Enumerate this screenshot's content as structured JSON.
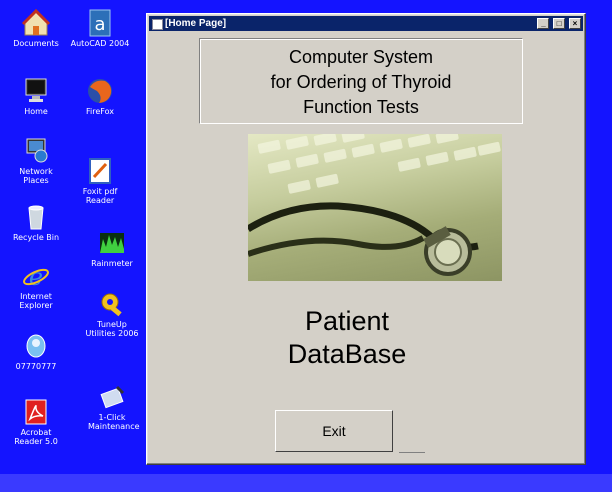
{
  "desktop": {
    "icons": [
      {
        "label": "Documents"
      },
      {
        "label": "AutoCAD 2004"
      },
      {
        "label": "Home"
      },
      {
        "label": "FireFox"
      },
      {
        "label": "Network Places"
      },
      {
        "label": "Foxit pdf Reader"
      },
      {
        "label": "Recycle Bin"
      },
      {
        "label": "Rainmeter"
      },
      {
        "label": "Internet Explorer"
      },
      {
        "label": "TuneUp Utilities 2006"
      },
      {
        "label": "07770777"
      },
      {
        "label": "1-Click Maintenance"
      },
      {
        "label": "Acrobat Reader 5.0"
      }
    ]
  },
  "window": {
    "title": "[Home Page]",
    "controls": {
      "minimize": "_",
      "maximize": "□",
      "close": "×"
    }
  },
  "main": {
    "heading_line1": "Computer System",
    "heading_line2": "for Ordering  of Thyroid",
    "heading_line3": "Function Tests",
    "db_line1": "Patient",
    "db_line2": "DataBase",
    "exit_label": "Exit"
  },
  "colors": {
    "desktop_bg": "#1414ff",
    "titlebar_bg": "#0a246a",
    "window_bg": "#d4d0c8"
  }
}
